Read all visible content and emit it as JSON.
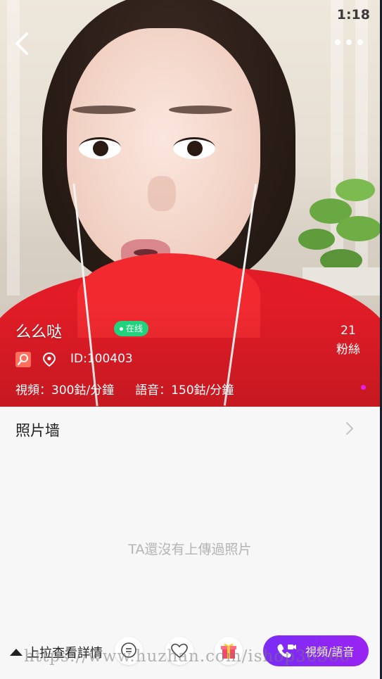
{
  "status": {
    "time": "1:18"
  },
  "nav": {
    "back_icon": "back-chevron-icon",
    "more_icon": "more-dots-icon"
  },
  "profile": {
    "nickname": "么么哒",
    "online_label": "在线",
    "id_text": "ID:100403",
    "video_rate": "視頻：300鈷/分鐘",
    "voice_rate": "語音：150鈷/分鐘",
    "fans_count": "21",
    "fans_label": "粉絲"
  },
  "photo_wall": {
    "title": "照片墙",
    "empty_text": "TA還沒有上傳過照片"
  },
  "bottom_bar": {
    "pull_label": "上拉查看詳情",
    "call_label": "視頻/語音"
  },
  "watermark": "https://www.huzhan.com/ishop36366",
  "colors": {
    "online": "#21d37d",
    "call_button": "#8a26f4",
    "hoodie": "#e11c26",
    "empty_text": "#b4b4b4"
  }
}
